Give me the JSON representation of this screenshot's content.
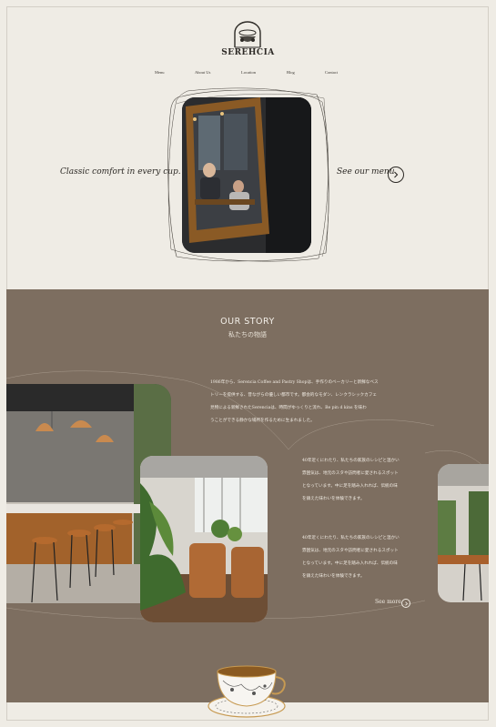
{
  "brand": {
    "name": "SEREHCIA"
  },
  "nav": {
    "items": [
      "Menu",
      "About Us",
      "Location",
      "Blog",
      "Contact"
    ]
  },
  "hero": {
    "tagline": "Classic comfort in every cup.",
    "cta": "See our menu"
  },
  "story": {
    "title": "OUR STORY",
    "subtitle": "私たちの物語",
    "paragraph1": [
      "1986年から、Serencia Coffee and Pastry Shopは、手作りのベーカリーと新鮮なべス",
      "トリーを提供する、昔ながらの優しい都市です。都会的なモダン、レンクラシックカフェ",
      "見物による新鮮されたSerenciaは、時間がゆっくりと流れ、Be pin d kins を味わ",
      "うことができる静かな場所を作るために生まれました。"
    ],
    "paragraph2": [
      "40年近くにわたり、私たちの家族のレシピと温かい",
      "雰囲気は、地元のスタや訪問者に愛されるスポット",
      "となっています。中に足を踏み入れれば、伝統の味",
      "を鎮えた味わいを体験できます。"
    ],
    "paragraph3": [
      "40年近くにわたり、私たちの家族のレシピと温かい",
      "雰囲気は、地元のスタや訪問者に愛されるスポット",
      "となっています。中に足を踏み入れれば、伝統の味",
      "を鎮えた味わいを体験できます。"
    ],
    "cta": "See more"
  },
  "colors": {
    "background": "#efece5",
    "story_background": "#7d6e60",
    "text": "#2c2925"
  }
}
